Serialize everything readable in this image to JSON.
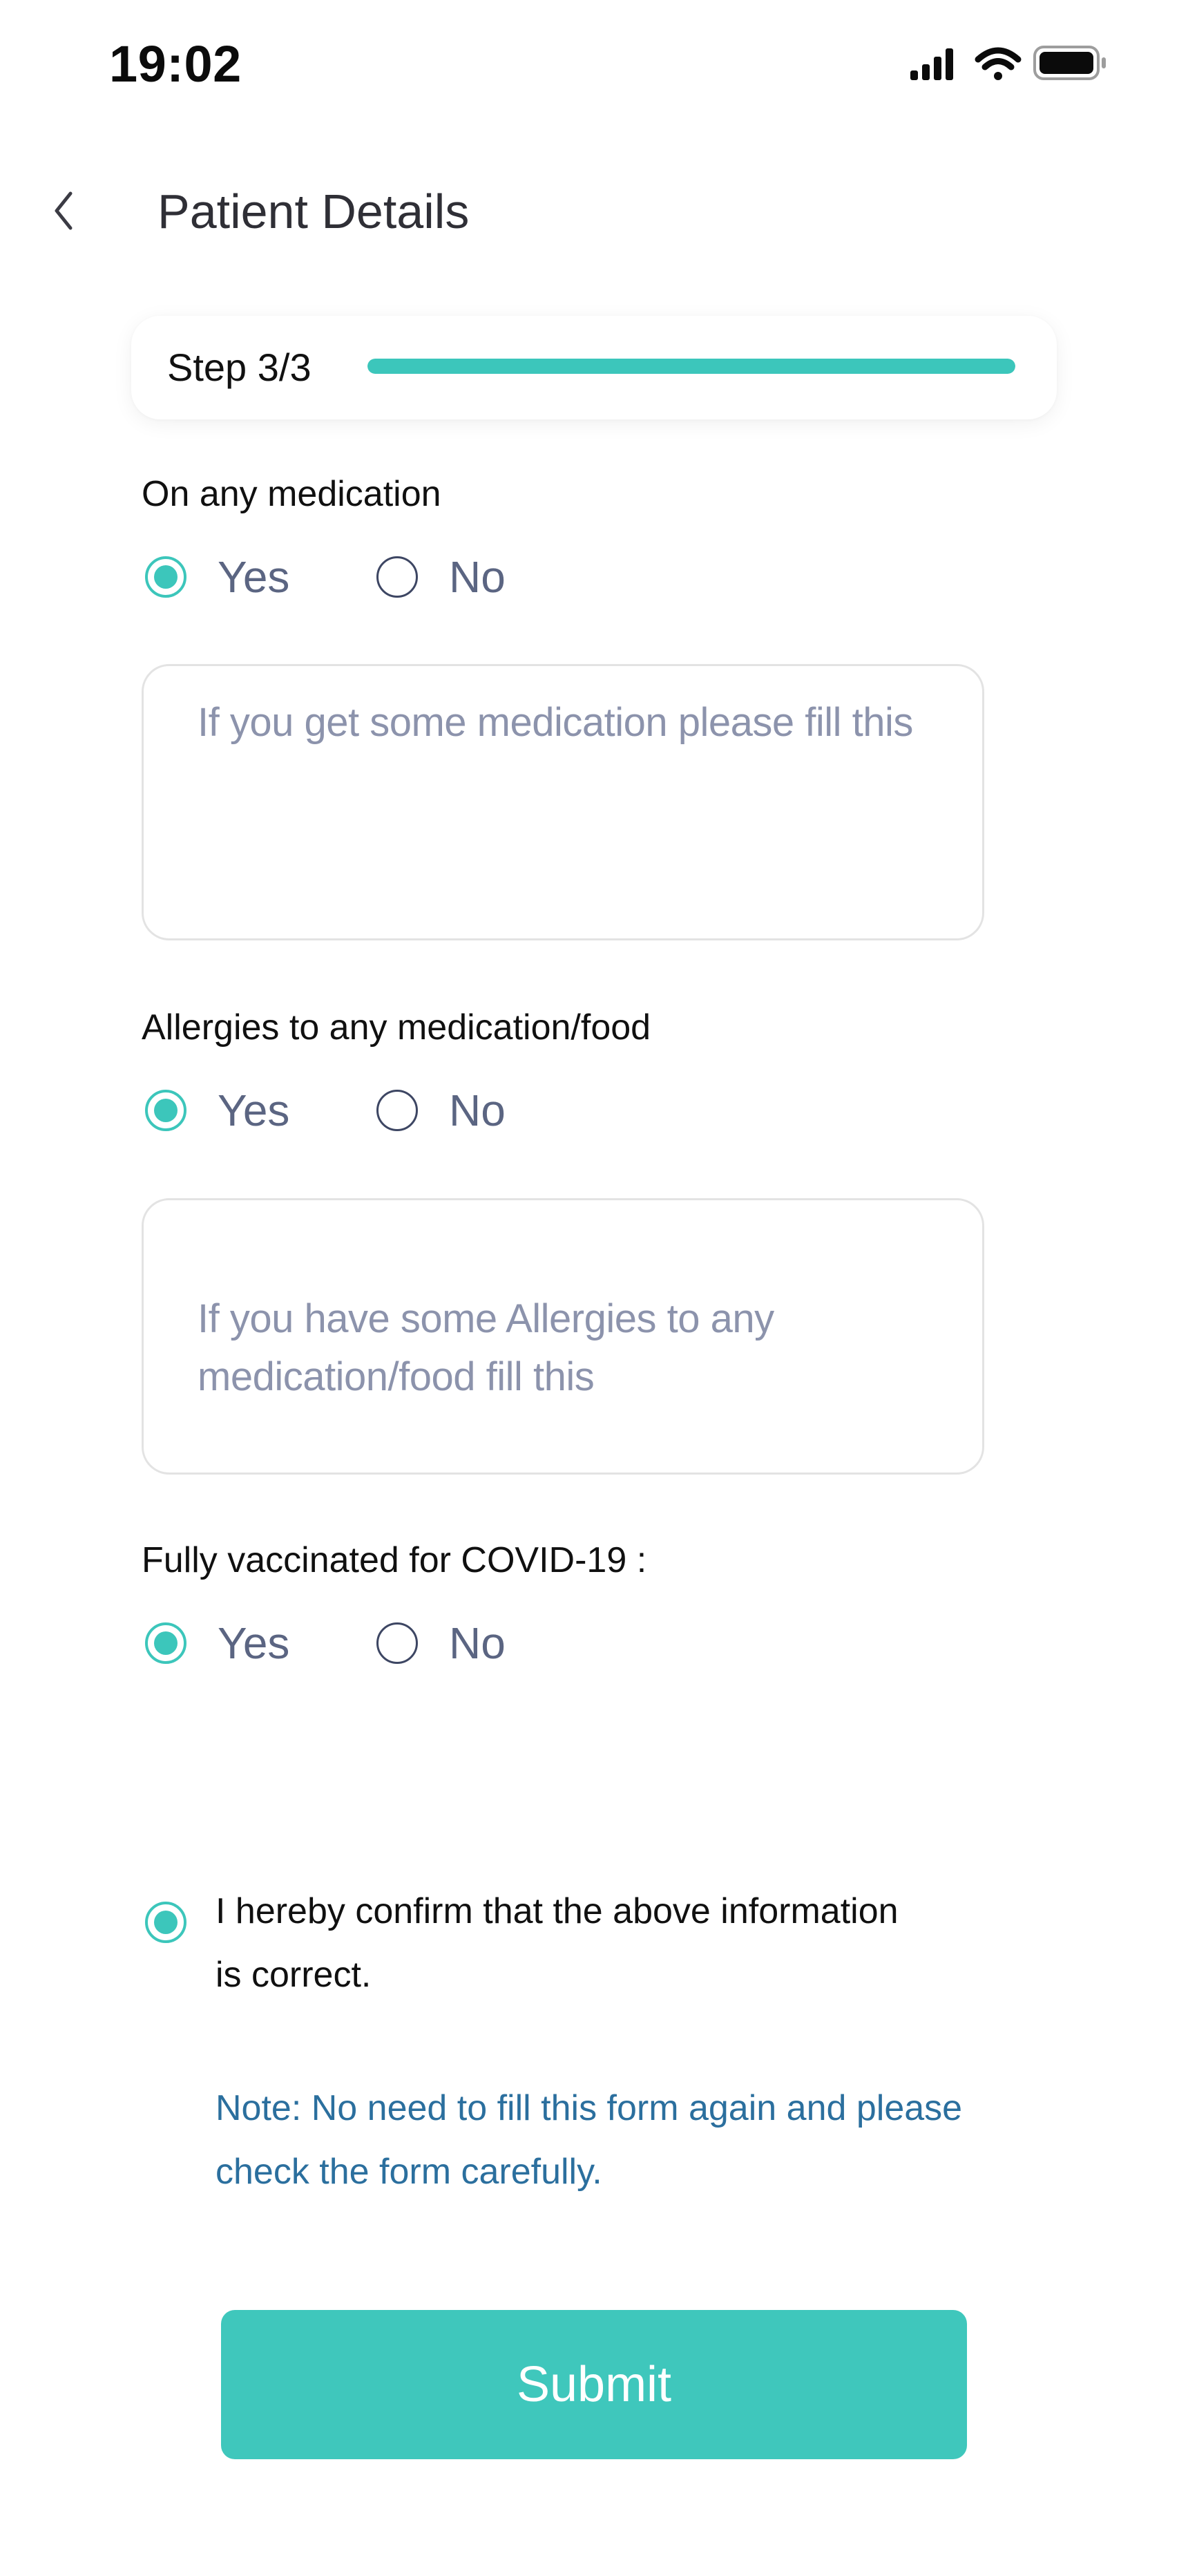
{
  "status_bar": {
    "time": "19:02"
  },
  "header": {
    "title": "Patient Details"
  },
  "step": {
    "label": "Step 3/3",
    "progress": 1.0
  },
  "questions": [
    {
      "label": "On any medication",
      "yes_label": "Yes",
      "no_label": "No",
      "selected": "Yes",
      "textarea_placeholder": "If you get some medication please fill this"
    },
    {
      "label": "Allergies to any medication/food",
      "yes_label": "Yes",
      "no_label": "No",
      "selected": "Yes",
      "textarea_placeholder_line1": "If you have some Allergies to any",
      "textarea_placeholder_line2": "medication/food fill this"
    },
    {
      "label": "Fully vaccinated for COVID-19 :",
      "yes_label": "Yes",
      "no_label": "No",
      "selected": "Yes"
    }
  ],
  "confirm": {
    "line1": "I hereby confirm that the above information",
    "line2": "is correct.",
    "checked": true
  },
  "note": {
    "line1": "Note: No need to fill this form again and please",
    "line2": "check the form carefully."
  },
  "submit_label": "Submit",
  "colors": {
    "accent": "#3cc6bb",
    "note": "#2b6f9e",
    "radio_text": "#5b6582",
    "placeholder": "#8c93ac"
  }
}
